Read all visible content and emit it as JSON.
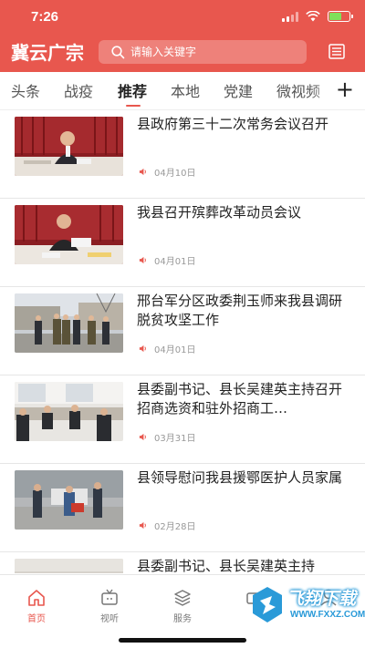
{
  "status_bar": {
    "time": "7:26"
  },
  "header": {
    "logo": "冀云广宗",
    "search_placeholder": "请输入关键字",
    "accent_color": "#e8574e"
  },
  "tabs": [
    {
      "label": "头条"
    },
    {
      "label": "战疫"
    },
    {
      "label": "推荐",
      "active": true
    },
    {
      "label": "本地"
    },
    {
      "label": "党建"
    },
    {
      "label": "微视频"
    }
  ],
  "add_tab_label": "+",
  "news": [
    {
      "title": "县政府第三十二次常务会议召开",
      "date": "04月10日"
    },
    {
      "title": "我县召开殡葬改革动员会议",
      "date": "04月01日"
    },
    {
      "title": "邢台军分区政委荆玉师来我县调研脱贫攻坚工作",
      "date": "04月01日"
    },
    {
      "title": "县委副书记、县长吴建英主持召开招商选资和驻外招商工…",
      "date": "03月31日"
    },
    {
      "title": "县领导慰问我县援鄂医护人员家属",
      "date": "02月28日"
    },
    {
      "title": "县委副书记、县长吴建英主持",
      "date": ""
    }
  ],
  "bottom_nav": [
    {
      "label": "首页",
      "icon": "home-icon",
      "active": true
    },
    {
      "label": "视听",
      "icon": "tv-icon"
    },
    {
      "label": "服务",
      "icon": "service-icon"
    },
    {
      "label": "",
      "icon": "video-icon"
    },
    {
      "label": "",
      "icon": "user-icon"
    }
  ],
  "watermark": {
    "text": "飞翔下载",
    "url": "WWW.FXXZ.COM"
  }
}
